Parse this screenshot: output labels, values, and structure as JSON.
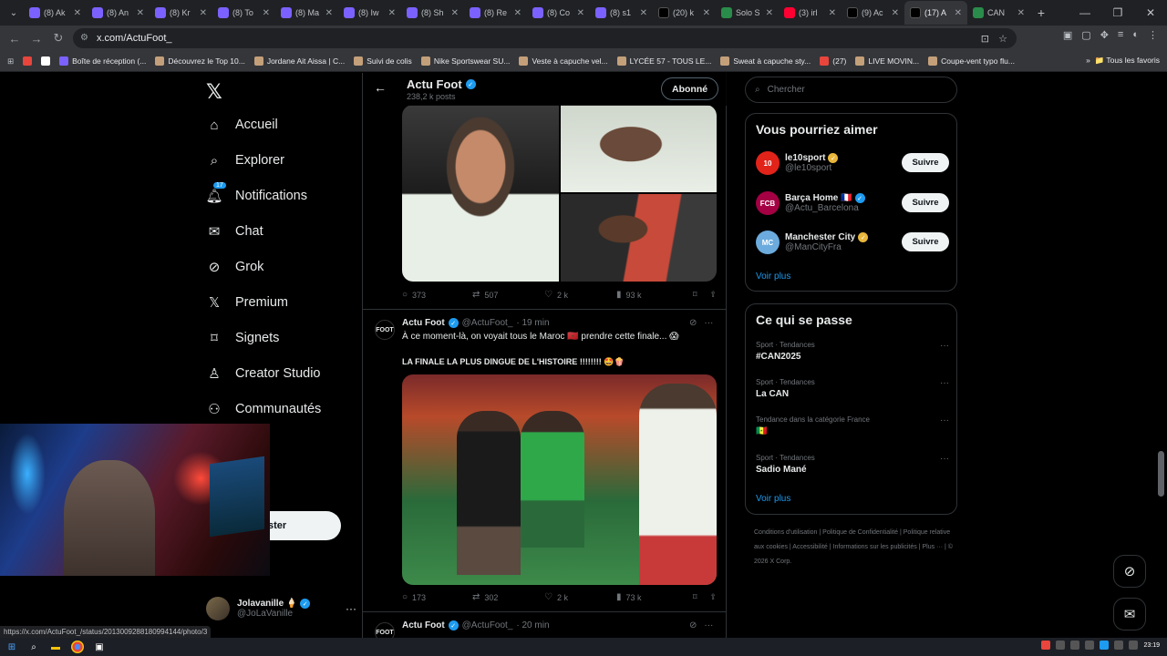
{
  "browser": {
    "tabs": [
      {
        "title": "(8) Ak",
        "icon": "twitch-icon"
      },
      {
        "title": "(8) An",
        "icon": "twitch-icon"
      },
      {
        "title": "(8) Kr",
        "icon": "twitch-icon"
      },
      {
        "title": "(8) To",
        "icon": "twitch-icon"
      },
      {
        "title": "(8) Ma",
        "icon": "twitch-icon"
      },
      {
        "title": "(8) Iw",
        "icon": "twitch-icon"
      },
      {
        "title": "(8) Sh",
        "icon": "twitch-icon"
      },
      {
        "title": "(8) Re",
        "icon": "twitch-icon"
      },
      {
        "title": "(8) Co",
        "icon": "twitch-icon"
      },
      {
        "title": "(8) s1",
        "icon": "twitch-icon"
      },
      {
        "title": "(20) k",
        "icon": "x-icon"
      },
      {
        "title": "Solo S",
        "icon": "site-icon"
      },
      {
        "title": "(3) irl",
        "icon": "youtube-icon"
      },
      {
        "title": "(9) Ac",
        "icon": "x-icon"
      },
      {
        "title": "(17) A",
        "icon": "x-icon",
        "active": true
      },
      {
        "title": "CAN",
        "icon": "site-icon"
      }
    ],
    "url": "x.com/ActuFoot_",
    "bookmarks": [
      {
        "label": "",
        "icon": "youtube-icon"
      },
      {
        "label": "",
        "icon": "gmail-icon"
      },
      {
        "label": "Boîte de réception (...",
        "icon": "mail-icon"
      },
      {
        "label": "Découvrez le Top 10...",
        "icon": "site-icon"
      },
      {
        "label": "Jordane Ait Aissa | C...",
        "icon": "site-icon"
      },
      {
        "label": "Suivi de colis",
        "icon": "site-icon"
      },
      {
        "label": "Nike Sportswear SU...",
        "icon": "site-icon"
      },
      {
        "label": "Veste à capuche vel...",
        "icon": "site-icon"
      },
      {
        "label": "LYCÉE 57 - TOUS LE...",
        "icon": "site-icon"
      },
      {
        "label": "Sweat à capuche sty...",
        "icon": "site-icon"
      },
      {
        "label": "(27)",
        "icon": "youtube-icon"
      },
      {
        "label": "LIVE MOVIN...",
        "icon": "site-icon"
      },
      {
        "label": "Coupe-vent typo flu...",
        "icon": "site-icon"
      }
    ],
    "all_bookmarks": "Tous les favoris",
    "status_url": "https://x.com/ActuFoot_/status/2013009288180994144/photo/3"
  },
  "sidebar": {
    "nav": [
      {
        "label": "Accueil",
        "icon": "home-icon"
      },
      {
        "label": "Explorer",
        "icon": "search-icon"
      },
      {
        "label": "Notifications",
        "icon": "bell-icon",
        "badge": "17"
      },
      {
        "label": "Chat",
        "icon": "mail-icon"
      },
      {
        "label": "Grok",
        "icon": "grok-icon"
      },
      {
        "label": "Premium",
        "icon": "x-icon"
      },
      {
        "label": "Signets",
        "icon": "bookmark-icon"
      },
      {
        "label": "Creator Studio",
        "icon": "creator-icon"
      },
      {
        "label": "Communautés",
        "icon": "people-icon"
      }
    ],
    "post_button_visible": "ster",
    "profile": {
      "name": "Jolavanille",
      "handle": "@JoLaVanille",
      "emoji": "🍦"
    }
  },
  "main": {
    "header": {
      "title": "Actu Foot",
      "posts": "238,2 k posts",
      "follow_label": "Abonné"
    },
    "tweet1_stats": {
      "replies": "373",
      "reposts": "507",
      "likes": "2 k",
      "views": "93 k"
    },
    "tweet2": {
      "name": "Actu Foot",
      "handle": "@ActuFoot_",
      "time": "· 19 min",
      "avatar": "FOOT",
      "text": "À ce moment-là, on voyait tous le Maroc 🇲🇦 prendre cette finale... 😱",
      "bold_text": "LA FINALE LA PLUS DINGUE DE L'HISTOIRE !!!!!!!! 🤩🍿",
      "stats": {
        "replies": "173",
        "reposts": "302",
        "likes": "2 k",
        "views": "73 k"
      }
    },
    "tweet3": {
      "name": "Actu Foot",
      "handle": "@ActuFoot_",
      "time": "· 20 min",
      "avatar": "FOOT"
    }
  },
  "right": {
    "search_placeholder": "Chercher",
    "suggestions_title": "Vous pourriez aimer",
    "suggestions": [
      {
        "name": "le10sport",
        "handle": "@le10sport",
        "badge": "gold",
        "avatar": "10",
        "color": "#e2231a"
      },
      {
        "name": "Barça Home 🇫🇷",
        "handle": "@Actu_Barcelona",
        "badge": "blue",
        "avatar": "FCB",
        "color": "#a50044"
      },
      {
        "name": "Manchester City",
        "handle": "@ManCityFra",
        "badge": "gold",
        "avatar": "MC",
        "color": "#6cabdd"
      }
    ],
    "follow_label": "Suivre",
    "see_more": "Voir plus",
    "trends_title": "Ce qui se passe",
    "trends": [
      {
        "category": "Sport · Tendances",
        "title": "#CAN2025"
      },
      {
        "category": "Sport · Tendances",
        "title": "La CAN"
      },
      {
        "category": "Tendance dans la catégorie France",
        "title": "🇸🇳"
      },
      {
        "category": "Sport · Tendances",
        "title": "Sadio Mané"
      }
    ],
    "footer": [
      "Conditions d'utilisation",
      "Politique de Confidentialité",
      "Politique relative aux cookies",
      "Accessibilité",
      "Informations sur les publicités",
      "Plus ···",
      "© 2026 X Corp."
    ]
  },
  "taskbar": {
    "time": "23:19"
  }
}
